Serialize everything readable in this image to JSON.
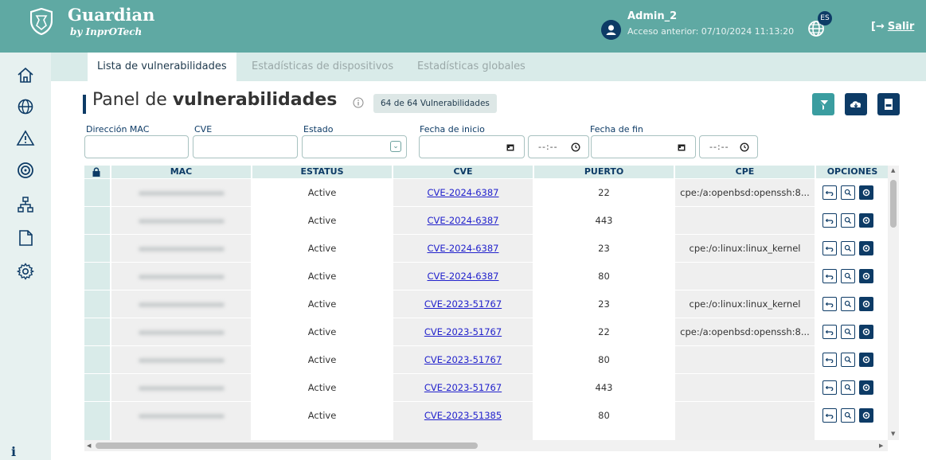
{
  "header": {
    "brand_title": "Guardian",
    "brand_subtitle": "by InprOTech",
    "user_name": "Admin_2",
    "last_access": "Acceso anterior: 07/10/2024 11:13:20",
    "language_badge": "ES",
    "logout_icon": "[→",
    "logout_label": "Salir"
  },
  "sidebar": {
    "items": [
      "home-icon",
      "globe-icon",
      "warning-icon",
      "radar-icon",
      "network-icon",
      "document-icon",
      "settings-icon"
    ],
    "info_label": "i"
  },
  "tabs": [
    {
      "label": "Lista de vulnerabilidades",
      "active": true
    },
    {
      "label": "Estadísticas de dispositivos",
      "active": false
    },
    {
      "label": "Estadísticas globales",
      "active": false
    }
  ],
  "panel": {
    "title_light": "Panel de ",
    "title_bold": "vulnerabilidades",
    "count_badge": "64 de 64 Vulnerabilidades"
  },
  "filters": {
    "mac_label": "Dirección MAC",
    "cve_label": "CVE",
    "status_label": "Estado",
    "start_label": "Fecha de inicio",
    "end_label": "Fecha de fin",
    "time_placeholder": "--:--"
  },
  "table": {
    "columns": [
      "MAC",
      "ESTATUS",
      "CVE",
      "PUERTO",
      "CPE",
      "OPCIONES"
    ],
    "rows": [
      {
        "status": "Active",
        "cve": "CVE-2024-6387",
        "port": "22",
        "cpe": "cpe:/a:openbsd:openssh:8..."
      },
      {
        "status": "Active",
        "cve": "CVE-2024-6387",
        "port": "443",
        "cpe": ""
      },
      {
        "status": "Active",
        "cve": "CVE-2024-6387",
        "port": "23",
        "cpe": "cpe:/o:linux:linux_kernel"
      },
      {
        "status": "Active",
        "cve": "CVE-2024-6387",
        "port": "80",
        "cpe": ""
      },
      {
        "status": "Active",
        "cve": "CVE-2023-51767",
        "port": "23",
        "cpe": "cpe:/o:linux:linux_kernel"
      },
      {
        "status": "Active",
        "cve": "CVE-2023-51767",
        "port": "22",
        "cpe": "cpe:/a:openbsd:openssh:8..."
      },
      {
        "status": "Active",
        "cve": "CVE-2023-51767",
        "port": "80",
        "cpe": ""
      },
      {
        "status": "Active",
        "cve": "CVE-2023-51767",
        "port": "443",
        "cpe": ""
      },
      {
        "status": "Active",
        "cve": "CVE-2023-51385",
        "port": "80",
        "cpe": ""
      }
    ]
  },
  "colors": {
    "header_bg": "#5fa9a3",
    "navy": "#0d3b66",
    "teal": "#3a9da0",
    "table_header_bg": "#d9ebe9"
  }
}
